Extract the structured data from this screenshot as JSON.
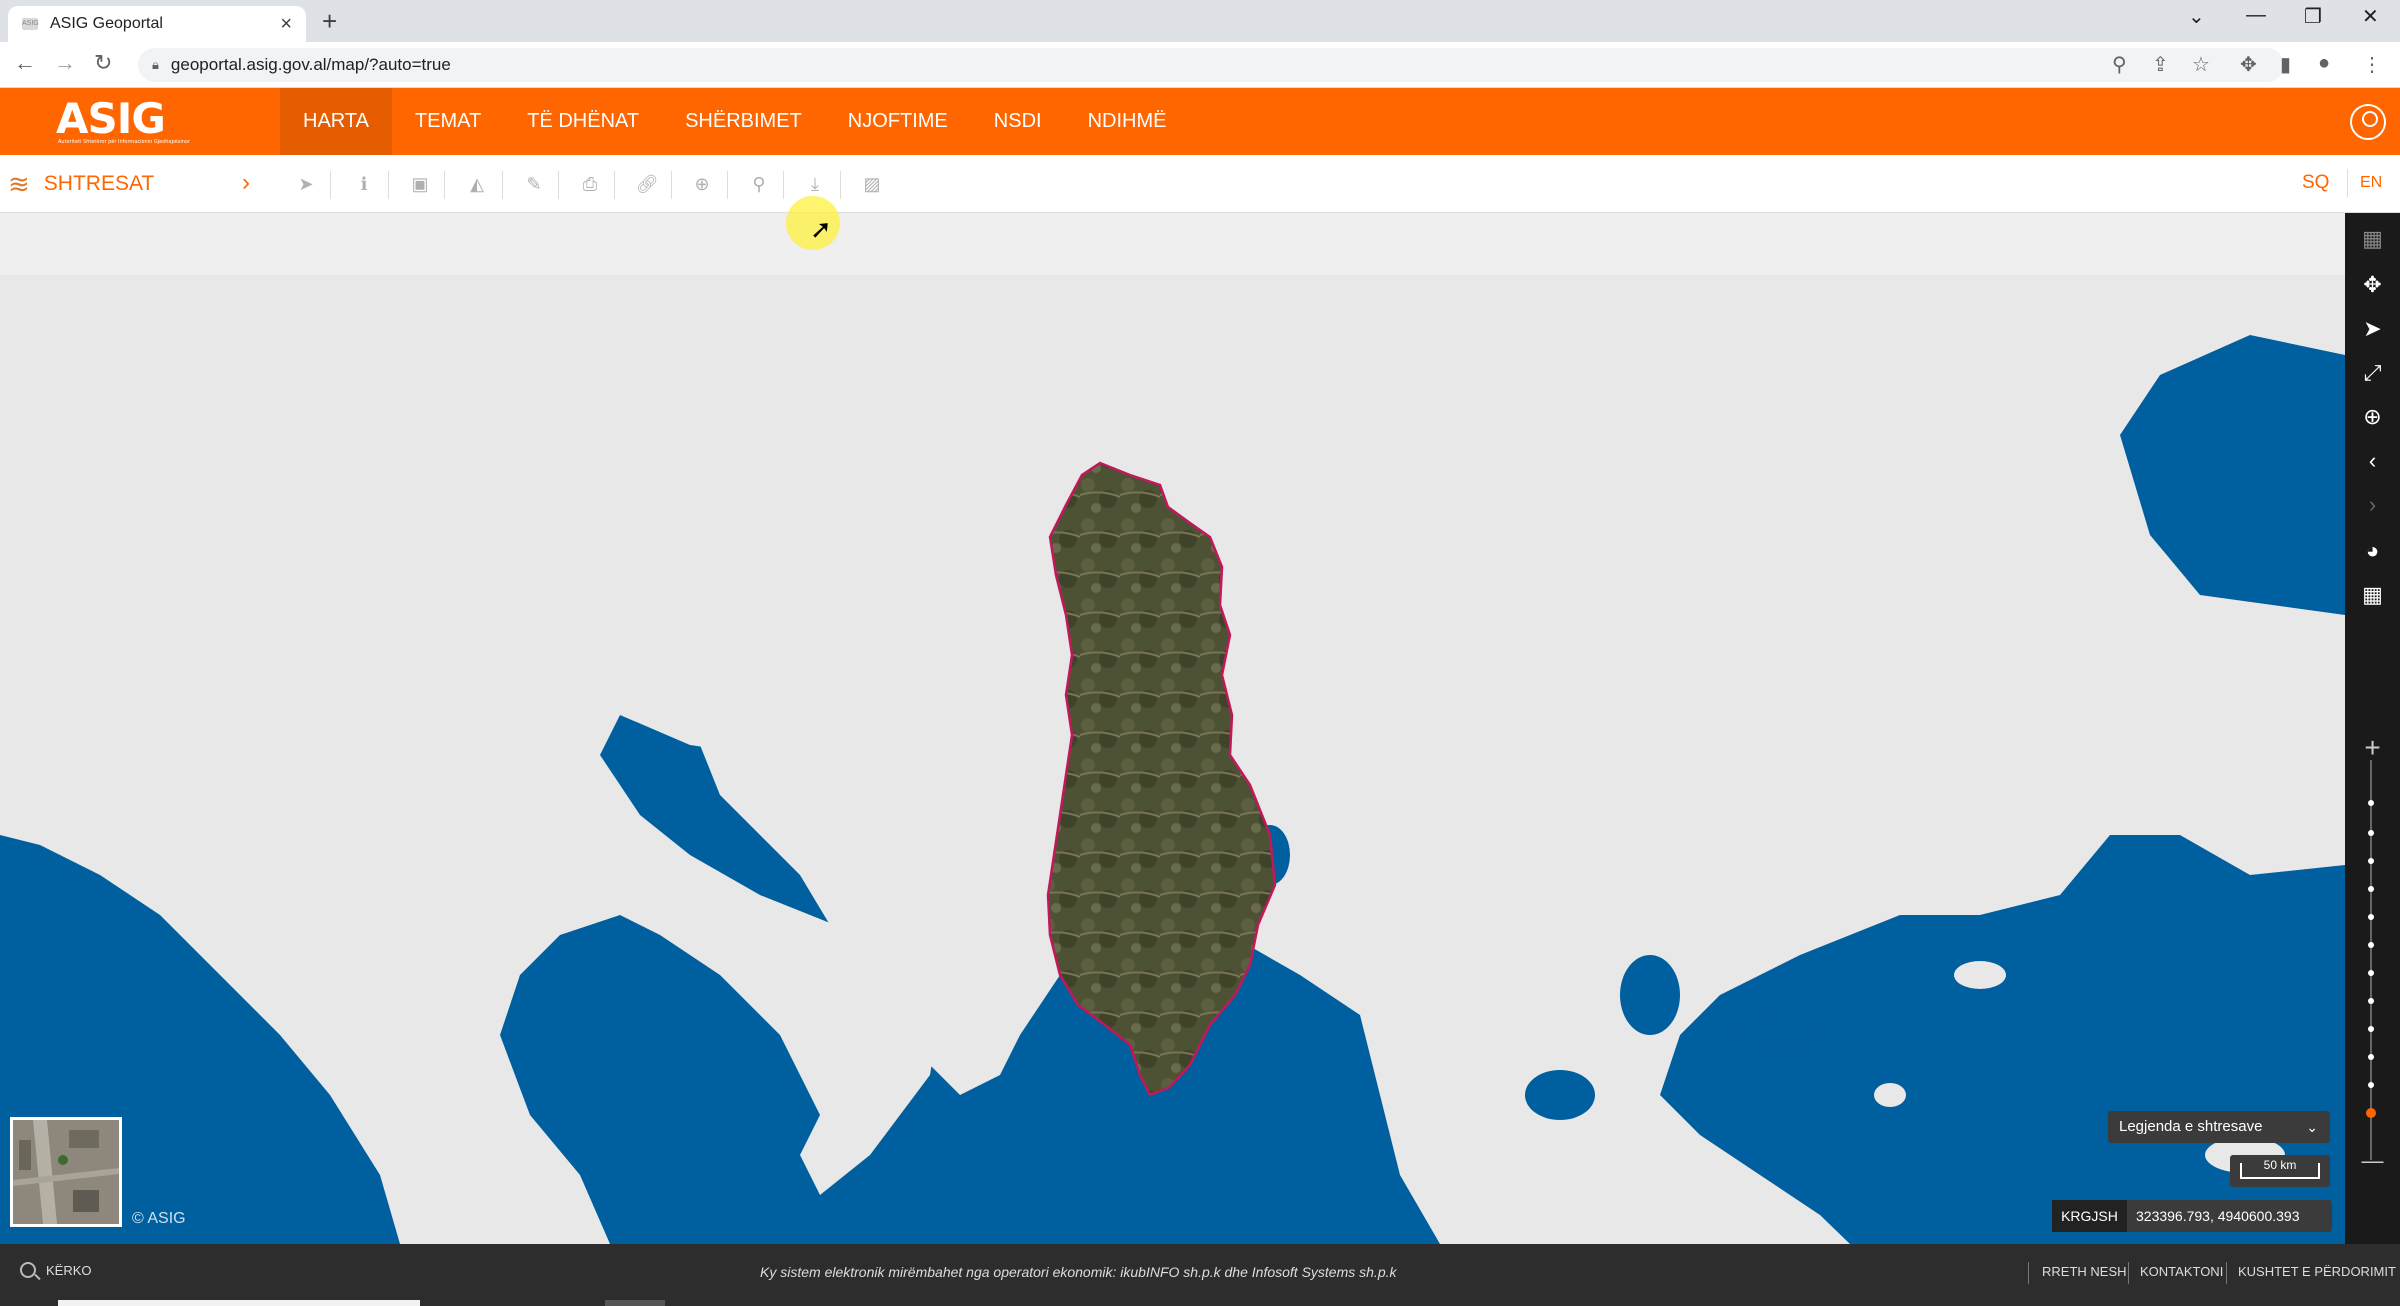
{
  "browser": {
    "tab_title": "ASIG Geoportal",
    "favicon_text": "ASIG",
    "url": "geoportal.asig.gov.al/map/?auto=true"
  },
  "header": {
    "logo": "ASIG",
    "logo_subtitle": "Autoriteti Shtetëror për Informacionin Gjeohapësinor",
    "nav": [
      "HARTA",
      "TEMAT",
      "TË DHËNAT",
      "SHËRBIMET",
      "NJOFTIME",
      "NSDI",
      "NDIHMË"
    ],
    "active_nav": "HARTA"
  },
  "toolbar": {
    "layers_label": "SHTRESAT",
    "tools": [
      "select-tool-icon",
      "info-icon",
      "area-icon",
      "profile-icon",
      "edit-icon",
      "print-icon",
      "link-icon",
      "add-icon",
      "search-icon",
      "download-icon",
      "image-icon"
    ],
    "lang_sq": "SQ",
    "lang_en": "EN"
  },
  "map": {
    "copyright": "© ASIG",
    "legend_label": "Legjenda e shtresave",
    "scale_label": "50 km",
    "projection": "KRGJSH",
    "coordinates": "323396.793, 4940600.393",
    "colors": {
      "sea": "#005f9e",
      "land": "#e8e8e8",
      "albania": "#4e5234",
      "border": "#c2185b"
    }
  },
  "rail": {
    "icons": [
      "basemap-icon",
      "fullscreen-icon",
      "locate-icon",
      "expand-icon",
      "zoom-area-icon",
      "back-icon",
      "forward-icon",
      "globe-icon",
      "grid-icon"
    ],
    "zoom_in": "+",
    "zoom_out": "—"
  },
  "footer": {
    "search_label": "KËRKO",
    "message": "Ky sistem elektronik mirëmbahet nga operatori ekonomik: ikubINFO sh.p.k dhe Infosoft Systems sh.p.k",
    "links": [
      "RRETH NESH",
      "KONTAKTONI",
      "KUSHTET E PËRDORIMIT"
    ]
  }
}
